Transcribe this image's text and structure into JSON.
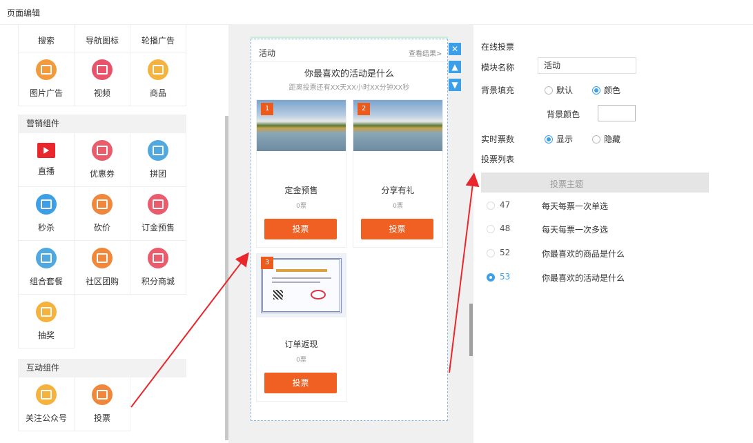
{
  "header": {
    "title": "页面编辑"
  },
  "components": {
    "top_row": [
      "搜索",
      "导航图标",
      "轮播广告"
    ],
    "basic": [
      {
        "label": "图片广告",
        "icon": "image-ad-icon",
        "color": "#f39a3c"
      },
      {
        "label": "视频",
        "icon": "video-icon",
        "color": "#e8536a"
      },
      {
        "label": "商品",
        "icon": "goods-icon",
        "color": "#f5b33e"
      }
    ],
    "marketing_title": "营销组件",
    "marketing": [
      {
        "label": "直播",
        "icon": "live-tv-icon",
        "color": "#e8262b"
      },
      {
        "label": "优惠券",
        "icon": "coupon-icon",
        "color": "#ea5b6b"
      },
      {
        "label": "拼团",
        "icon": "group-buy-icon",
        "color": "#4fa9e0"
      },
      {
        "label": "秒杀",
        "icon": "flash-sale-icon",
        "color": "#3c9fe8"
      },
      {
        "label": "砍价",
        "icon": "bargain-icon",
        "color": "#f0873a"
      },
      {
        "label": "订金预售",
        "icon": "presale-icon",
        "color": "#ea5b6b"
      },
      {
        "label": "组合套餐",
        "icon": "combo-icon",
        "color": "#4fa9e0"
      },
      {
        "label": "社区团购",
        "icon": "community-buy-icon",
        "color": "#f0873a"
      },
      {
        "label": "积分商城",
        "icon": "points-mall-icon",
        "color": "#ea5b6b"
      },
      {
        "label": "抽奖",
        "icon": "lottery-icon",
        "color": "#f5b33e"
      }
    ],
    "interactive_title": "互动组件",
    "interactive": [
      {
        "label": "关注公众号",
        "icon": "follow-account-icon",
        "color": "#f5b33e"
      },
      {
        "label": "投票",
        "icon": "vote-icon",
        "color": "#f0873a"
      }
    ]
  },
  "preview": {
    "module_title": "活动",
    "view_results": "查看结果>",
    "question": "你最喜欢的活动是什么",
    "countdown": "距离投票还有XX天XX小时XX分钟XX秒",
    "options": [
      {
        "num": "1",
        "title": "定金预售",
        "votes": "0票",
        "button": "投票",
        "image": "landscape"
      },
      {
        "num": "2",
        "title": "分享有礼",
        "votes": "0票",
        "button": "投票",
        "image": "landscape"
      },
      {
        "num": "3",
        "title": "订单返现",
        "votes": "0票",
        "button": "投票",
        "image": "certificate"
      }
    ],
    "tools": {
      "close": "✕",
      "up": "▲",
      "down": "▼"
    }
  },
  "settings": {
    "section_title": "在线投票",
    "name_label": "模块名称",
    "name_value": "活动",
    "bg_label": "背景填充",
    "bg_options": [
      "默认",
      "颜色"
    ],
    "bg_selected": 1,
    "bg_color_label": "背景颜色",
    "realtime_label": "实时票数",
    "realtime_options": [
      "显示",
      "隐藏"
    ],
    "realtime_selected": 0,
    "list_label": "投票列表",
    "table_header": "投票主题",
    "rows": [
      {
        "id": "47",
        "topic": "每天每票一次单选",
        "selected": false
      },
      {
        "id": "48",
        "topic": "每天每票一次多选",
        "selected": false
      },
      {
        "id": "52",
        "topic": "你最喜欢的商品是什么",
        "selected": false
      },
      {
        "id": "53",
        "topic": "你最喜欢的活动是什么",
        "selected": true
      }
    ]
  },
  "colors": {
    "accent": "#3c9fe8",
    "vote_button": "#f06022",
    "badge": "#ec5a1c",
    "arrow": "#e8262b"
  }
}
